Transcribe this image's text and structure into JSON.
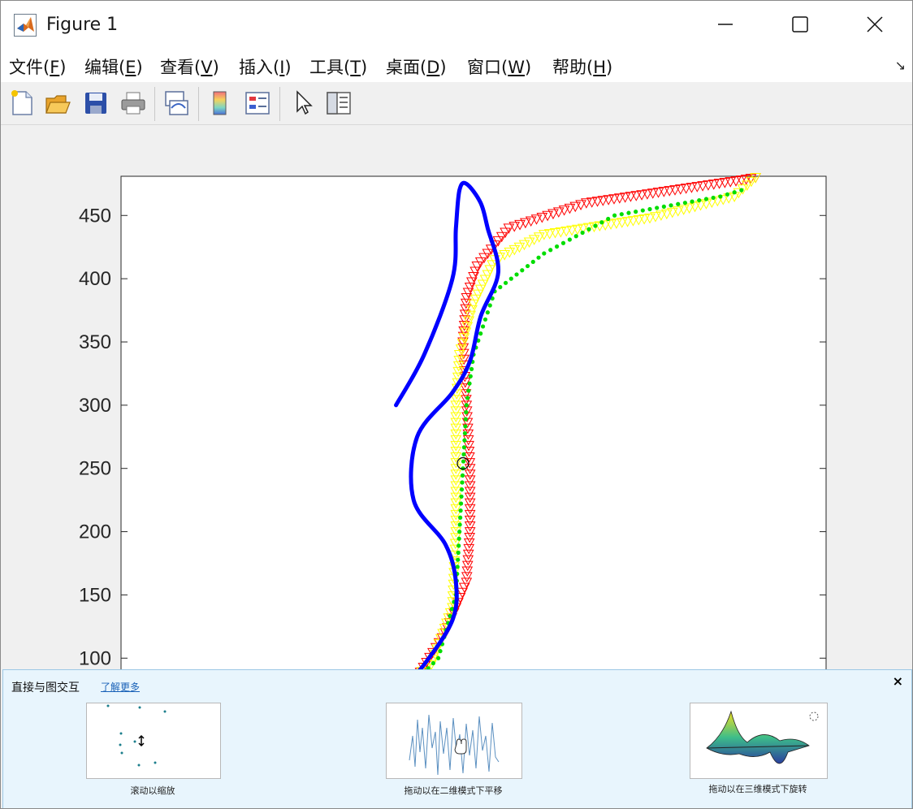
{
  "window": {
    "title": "Figure 1",
    "minimize_icon": "minimize-icon",
    "maximize_icon": "maximize-icon",
    "close_icon": "close-icon"
  },
  "menubar": {
    "items": [
      {
        "pre": "文件(",
        "key": "F",
        "post": ")"
      },
      {
        "pre": "编辑(",
        "key": "E",
        "post": ")"
      },
      {
        "pre": "查看(",
        "key": "V",
        "post": ")"
      },
      {
        "pre": "插入(",
        "key": "I",
        "post": ")"
      },
      {
        "pre": "工具(",
        "key": "T",
        "post": ")"
      },
      {
        "pre": "桌面(",
        "key": "D",
        "post": ")"
      },
      {
        "pre": "窗口(",
        "key": "W",
        "post": ")"
      },
      {
        "pre": "帮助(",
        "key": "H",
        "post": ")"
      }
    ],
    "collapse_glyph": "↘"
  },
  "toolbar": {
    "buttons": [
      "new-figure-icon",
      "open-file-icon",
      "save-icon",
      "print-icon",
      "link-plot-icon",
      "insert-colorbar-icon",
      "insert-legend-icon",
      "edit-plot-pointer-icon",
      "property-inspector-icon"
    ]
  },
  "chart_data": {
    "type": "line",
    "title": "",
    "xlabel": "",
    "ylabel": "",
    "yticks": [
      100,
      150,
      200,
      250,
      300,
      350,
      400,
      450
    ],
    "ylim": [
      70,
      481
    ],
    "xlim": [
      0,
      1
    ],
    "grid": false,
    "series": [
      {
        "marker": "triangle-down",
        "color": "#ff0000",
        "x": [
          0.38,
          0.42,
          0.46,
          0.49,
          0.495,
          0.495,
          0.49,
          0.485,
          0.49,
          0.505,
          0.55,
          0.66,
          0.88,
          0.9
        ],
        "y": [
          70,
          85,
          120,
          160,
          200,
          250,
          300,
          350,
          385,
          410,
          440,
          460,
          478,
          480
        ]
      },
      {
        "marker": "triangle-down",
        "color": "#ffff00",
        "x": [
          0.38,
          0.44,
          0.47,
          0.475,
          0.475,
          0.475,
          0.48,
          0.5,
          0.53,
          0.6,
          0.75,
          0.87,
          0.9
        ],
        "y": [
          70,
          95,
          140,
          200,
          250,
          300,
          340,
          380,
          415,
          435,
          448,
          465,
          480
        ]
      },
      {
        "marker": "dot",
        "color": "#00dd00",
        "x": [
          0.4,
          0.45,
          0.475,
          0.48,
          0.485,
          0.49,
          0.5,
          0.53,
          0.6,
          0.7,
          0.85,
          0.88
        ],
        "y": [
          72,
          100,
          150,
          200,
          250,
          300,
          340,
          390,
          420,
          450,
          465,
          470
        ]
      },
      {
        "marker": "none",
        "color": "#0000ff",
        "x": [
          0.39,
          0.43,
          0.47,
          0.475,
          0.46,
          0.415,
          0.42,
          0.47,
          0.495,
          0.51,
          0.535,
          0.52,
          0.51,
          0.49,
          0.48,
          0.475,
          0.47,
          0.43,
          0.39
        ],
        "y": [
          70,
          95,
          130,
          160,
          190,
          225,
          275,
          310,
          335,
          370,
          405,
          440,
          460,
          475,
          470,
          440,
          400,
          340,
          300
        ]
      },
      {
        "marker": "open-circle",
        "color": "#000000",
        "x": [
          0.485
        ],
        "y": [
          254
        ]
      }
    ]
  },
  "banner": {
    "title": "直接与图交互",
    "link": "了解更多",
    "close_glyph": "×",
    "demos": [
      {
        "caption": "滚动以缩放",
        "icon": "zoom-demo-icon"
      },
      {
        "caption": "拖动以在二维模式下平移",
        "icon": "pan-demo-icon"
      },
      {
        "caption": "拖动以在三维模式下旋转",
        "icon": "rotate-demo-icon"
      }
    ]
  }
}
